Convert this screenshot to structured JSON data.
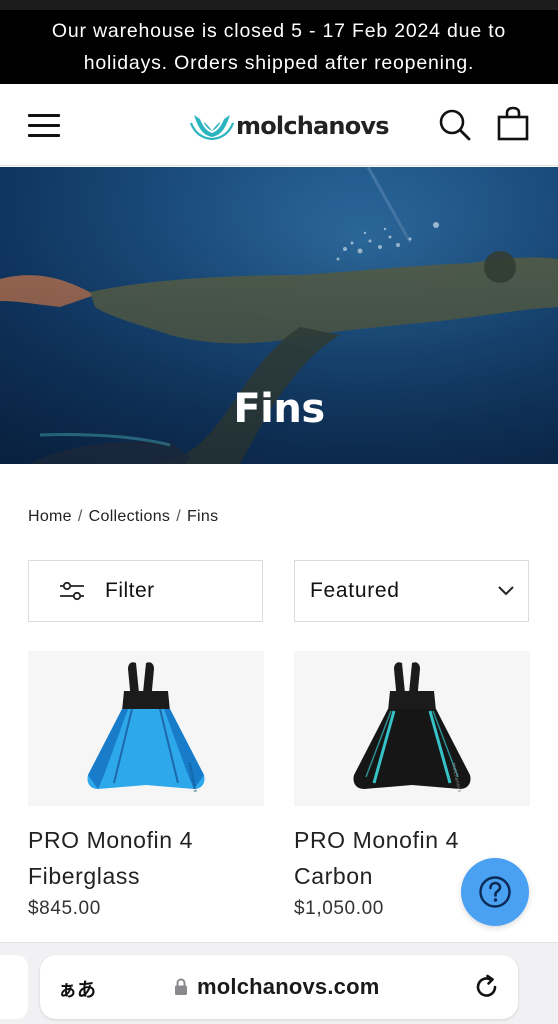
{
  "announcement": {
    "line1": "Our warehouse is closed 5 - 17 Feb 2024 due to",
    "line2": "holidays. Orders shipped after reopening."
  },
  "header": {
    "logo_text": "molchanovs",
    "icons": [
      "menu-icon",
      "search-icon",
      "cart-icon"
    ]
  },
  "hero": {
    "title": "Fins"
  },
  "breadcrumb": {
    "items": [
      "Home",
      "Collections",
      "Fins"
    ],
    "separator": "/"
  },
  "toolbar": {
    "filter_label": "Filter",
    "sort_label": "Featured"
  },
  "products": [
    {
      "name_line1": "PRO Monofin 4",
      "name_line2": "Fiberglass",
      "price": "$845.00",
      "blade_color": "#2da8ea"
    },
    {
      "name_line1": "PRO Monofin 4",
      "name_line2": "Carbon",
      "price": "$1,050.00",
      "blade_color": "#1a1a1a"
    }
  ],
  "help_button": {
    "icon": "question-icon",
    "color": "#4aa1f2"
  },
  "browser": {
    "aa_label": "ぁあ",
    "url": "molchanovs.com"
  },
  "colors": {
    "brand_teal": "#2bb3c0",
    "announcement_bg": "#000000"
  }
}
